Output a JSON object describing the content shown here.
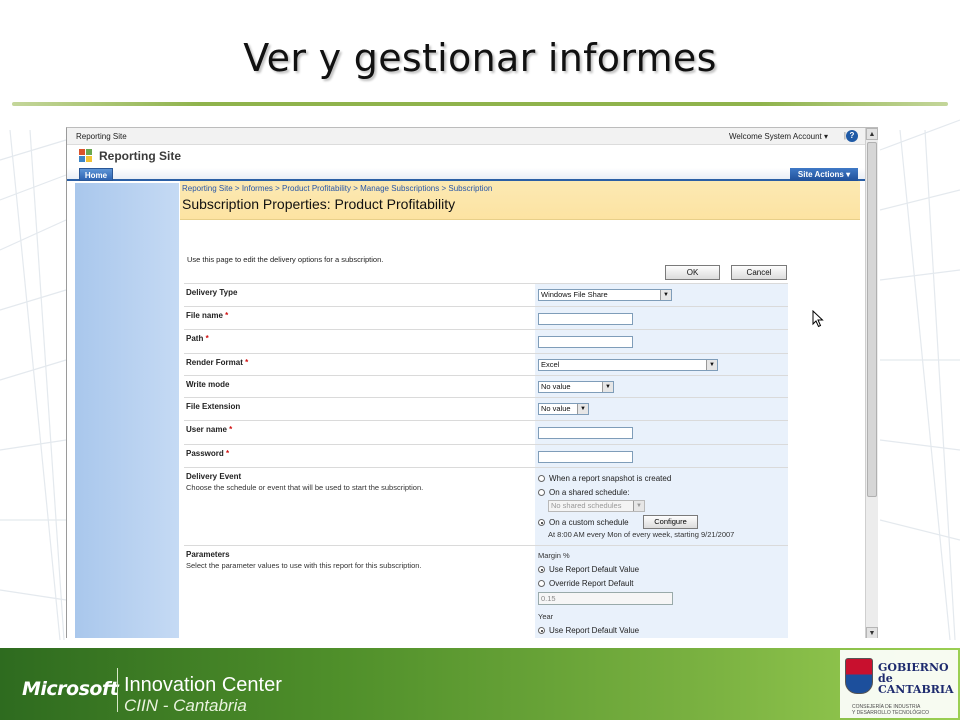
{
  "slide": {
    "title": "Ver y gestionar informes"
  },
  "browser": {
    "site_link": "Reporting Site",
    "welcome": "Welcome System Account ▾",
    "separator": "|",
    "help_glyph": "?"
  },
  "site": {
    "name": "Reporting Site",
    "home_tab": "Home",
    "site_actions": "Site Actions ▾"
  },
  "page": {
    "breadcrumb": "Reporting Site > Informes > Product Profitability > Manage Subscriptions > Subscription",
    "title": "Subscription Properties: Product Profitability",
    "intro": "Use this page to edit the delivery options for a subscription.",
    "ok_label": "OK",
    "cancel_label": "Cancel"
  },
  "form": {
    "delivery_type": {
      "label": "Delivery Type",
      "value": "Windows File Share"
    },
    "file_name": {
      "label": "File name",
      "required": "*",
      "value": ""
    },
    "path": {
      "label": "Path",
      "required": "*",
      "value": ""
    },
    "render_format": {
      "label": "Render Format",
      "required": "*",
      "value": "Excel"
    },
    "write_mode": {
      "label": "Write mode",
      "value": "No value"
    },
    "file_extension": {
      "label": "File Extension",
      "value": "No value"
    },
    "user_name": {
      "label": "User name",
      "required": "*",
      "value": ""
    },
    "password": {
      "label": "Password",
      "required": "*",
      "value": ""
    },
    "delivery_event": {
      "label": "Delivery Event",
      "description": "Choose the schedule or event that will be used to start the subscription.",
      "option_snapshot": "When a report snapshot is created",
      "option_shared": "On a shared schedule:",
      "shared_select": "No shared schedules",
      "option_custom": "On a custom schedule",
      "configure_label": "Configure",
      "schedule_text": "At 8:00 AM every Mon of every week, starting 9/21/2007",
      "selected": "custom"
    },
    "parameters": {
      "label": "Parameters",
      "description": "Select the parameter values to use with this report for this subscription.",
      "margin_label": "Margin %",
      "use_default": "Use Report Default Value",
      "override_default": "Override Report Default",
      "margin_value": "0.15",
      "year_label": "Year",
      "year_use_default": "Use Report Default Value"
    }
  },
  "footer": {
    "ms_logo": "Microsoft",
    "ic_line1": "Innovation Center",
    "ic_line2": "CIIN - Cantabria",
    "gov_line1": "GOBIERNO",
    "gov_line2": "de",
    "gov_line3": "CANTABRIA",
    "gov_sub1": "CONSEJERÍA DE INDUSTRIA",
    "gov_sub2": "Y DESARROLLO TECNOLÓGICO"
  },
  "colors": {
    "title_rule": "#8fb34c",
    "header_band": "#fde3a2",
    "leftnav": "#b8d1f0",
    "form_value_bg": "#e9f1fb",
    "footer_green": "#4f8f2a"
  }
}
